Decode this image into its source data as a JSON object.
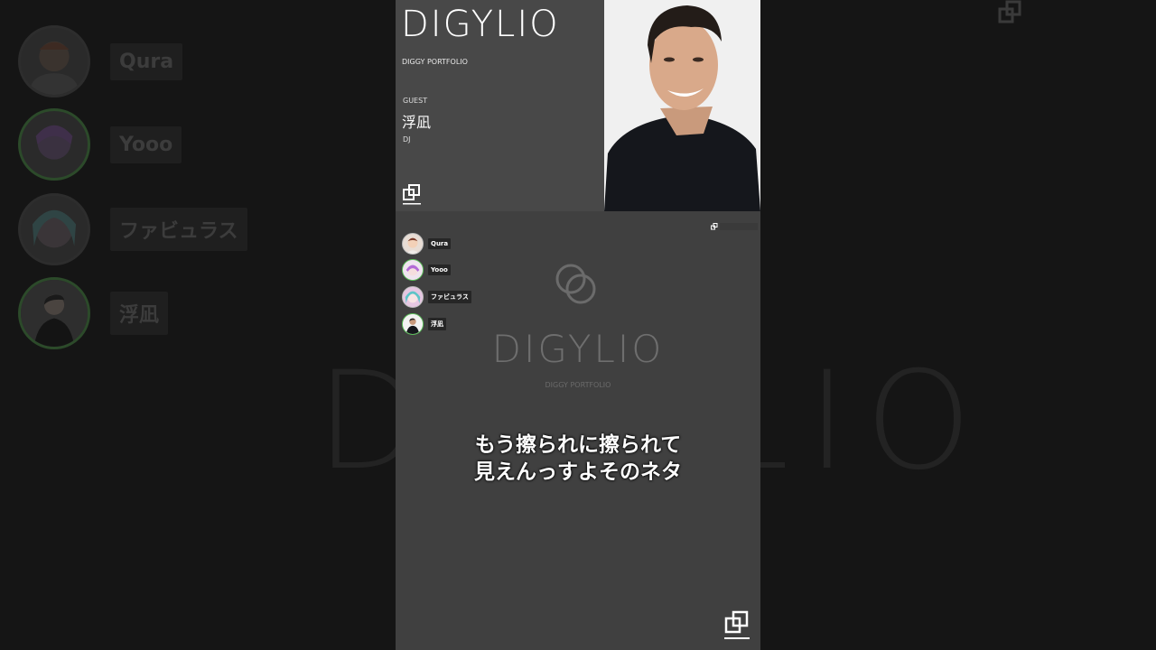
{
  "header": {
    "brand_title": "DIGYLIO",
    "brand_subtitle": "DIGGY PORTFOLIO",
    "guest_label": "GUEST",
    "guest_name": "浮凪",
    "guest_role": "DJ"
  },
  "members": [
    {
      "name": "Qura",
      "ring": "gray"
    },
    {
      "name": "Yooo",
      "ring": "green"
    },
    {
      "name": "ファビュラス",
      "ring": "gray"
    },
    {
      "name": "浮凪",
      "ring": "green"
    }
  ],
  "center": {
    "title": "DIGYLIO",
    "subtitle": "DIGGY PORTFOLIO"
  },
  "caption": {
    "line1": "もう擦られに擦られて",
    "line2": "見えんっすよそのネタ"
  },
  "background": {
    "big_text": "DIGYLIO",
    "labels": [
      "Qura",
      "Yooo",
      "ファビュラス",
      "浮凪"
    ]
  },
  "colors": {
    "accent_green": "#5cc25a",
    "panel_bg": "#404040",
    "header_bg": "#484848"
  }
}
